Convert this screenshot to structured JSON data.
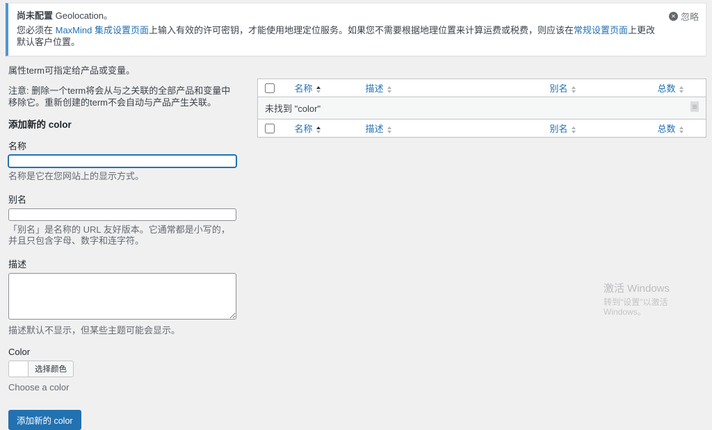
{
  "notice": {
    "title_bold": "尚未配置",
    "title_rest": " Geolocation。",
    "body_pre": "您必须在 ",
    "maxmind_link": "MaxMind 集成设置页面",
    "body_mid": "上输入有效的许可密钥，才能使用地理定位服务。如果您不需要根据地理位置来计算运费或税费，则应该在",
    "general_link": "常规设置页面",
    "body_post": "上更改默认客户位置。",
    "dismiss_label": "忽略"
  },
  "form": {
    "intro": "属性term可指定给产品或变量。",
    "note": "注意: 删除一个term将会从与之关联的全部产品和变量中移除它。重新创建的term不会自动与产品产生关联。",
    "heading": "添加新的 color",
    "name_label": "名称",
    "name_value": "",
    "name_help": "名称是它在您网站上的显示方式。",
    "slug_label": "别名",
    "slug_value": "",
    "slug_help": "「别名」是名称的 URL 友好版本。它通常都是小写的，并且只包含字母、数字和连字符。",
    "desc_label": "描述",
    "desc_value": "",
    "desc_help": "描述默认不显示，但某些主题可能会显示。",
    "color_label": "Color",
    "color_button_label": "选择颜色",
    "color_help": "Choose a color",
    "submit_label": "添加新的 color"
  },
  "table": {
    "columns": [
      "名称",
      "描述",
      "别名",
      "总数"
    ],
    "empty_text": "未找到 \"color\""
  },
  "icons": {
    "dismiss_glyph": "✕",
    "handle_glyph": "≡"
  },
  "watermark": {
    "line1": "激活 Windows",
    "line2": "转到\"设置\"以激活 Windows。"
  },
  "colors": {
    "accent_blue": "#2271b1",
    "notice_border_blue": "#4f94d4",
    "page_background": "#f0f0f1",
    "table_border": "#c3c4c7",
    "striped_row": "#f6f7f7"
  }
}
